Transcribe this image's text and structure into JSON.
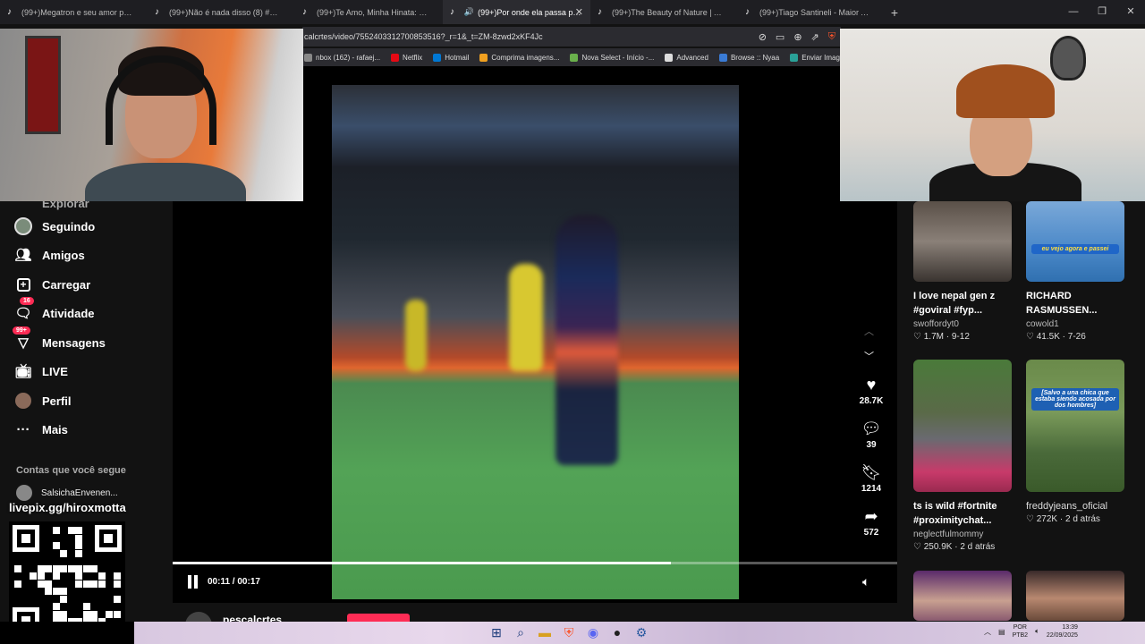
{
  "browser": {
    "tabs": [
      {
        "title": "(99+)Megatron e seu amor pelo cub",
        "active": false
      },
      {
        "title": "(99+)Não é nada disso (8) #gta #me",
        "active": false
      },
      {
        "title": "(99+)Te Amo, Minha Hinata: Uma M",
        "active": false
      },
      {
        "title": "(99+)Por onde ela passa para",
        "active": true
      },
      {
        "title": "(99+)The Beauty of Nature | A Thank",
        "active": false
      },
      {
        "title": "(99+)Tiago Santineli - Maior Adversá",
        "active": false
      }
    ],
    "new_tab": "+",
    "url": "calcrtes/video/7552403312700853516?_r=1&_t=ZM-8zwd2xKF4Jc",
    "bookmarks": [
      {
        "label": "nbox (162) - rafaej...",
        "color": "#888888"
      },
      {
        "label": "Netflix",
        "color": "#e50914"
      },
      {
        "label": "Hotmail",
        "color": "#0078d4"
      },
      {
        "label": "Comprima imagens...",
        "color": "#f0a020"
      },
      {
        "label": "Nova Select - Início -...",
        "color": "#6ab04c"
      },
      {
        "label": "Advanced",
        "color": "#dddddd"
      },
      {
        "label": "Browse :: Nyaa",
        "color": "#3a7bd5"
      },
      {
        "label": "Enviar Imagem",
        "color": "#2aa198"
      }
    ]
  },
  "sidebar": {
    "partial_top": "Explorar",
    "items": [
      {
        "label": "Seguindo",
        "icon": "following-avatar-icon",
        "badge": ""
      },
      {
        "label": "Amigos",
        "icon": "friends-icon",
        "badge": ""
      },
      {
        "label": "Carregar",
        "icon": "upload-icon",
        "badge": ""
      },
      {
        "label": "Atividade",
        "icon": "activity-icon",
        "badge": "16"
      },
      {
        "label": "Mensagens",
        "icon": "messages-icon",
        "badge": "99+"
      },
      {
        "label": "LIVE",
        "icon": "live-icon",
        "badge": ""
      },
      {
        "label": "Perfil",
        "icon": "profile-avatar-icon",
        "badge": ""
      },
      {
        "label": "Mais",
        "icon": "more-icon",
        "badge": ""
      }
    ],
    "following_title": "Contas que você segue",
    "following_first": "SalsichaEnvenen..."
  },
  "overlay": {
    "livepix": "livepix.gg/hiroxmotta"
  },
  "video": {
    "time_display": "00:11 / 00:17",
    "progress_fraction": 0.6875,
    "author": "pescalcrtes"
  },
  "actions": {
    "likes": "28.7K",
    "comments": "39",
    "saves": "1214",
    "shares": "572"
  },
  "recommendations": [
    {
      "caption": "I love nepal gen z #goviral #fyp...",
      "user": "swoffordyt0",
      "likes": "1.7M",
      "date": "9-12"
    },
    {
      "caption": "RICHARD RASMUSSEN...",
      "user": "cowold1",
      "likes": "41.5K",
      "date": "7-26",
      "thumb_text": "eu vejo agora e passei"
    },
    {
      "caption": "ts is wild #fortnite #proximitychat...",
      "user": "neglectfulmommy",
      "likes": "250.9K",
      "date": "2 d atrás"
    },
    {
      "caption": "",
      "user": "freddyjeans_oficial",
      "likes": "272K",
      "date": "2 d atrás",
      "thumb_text": "[Salvo a una chica que estaba siendo acosada por dos hombres]"
    }
  ],
  "taskbar": {
    "lang_top": "POR",
    "lang_bottom": "PTB2",
    "time": "13:39",
    "date": "22/09/2025"
  },
  "colors": {
    "accent": "#fe2c55",
    "background": "#121212"
  }
}
